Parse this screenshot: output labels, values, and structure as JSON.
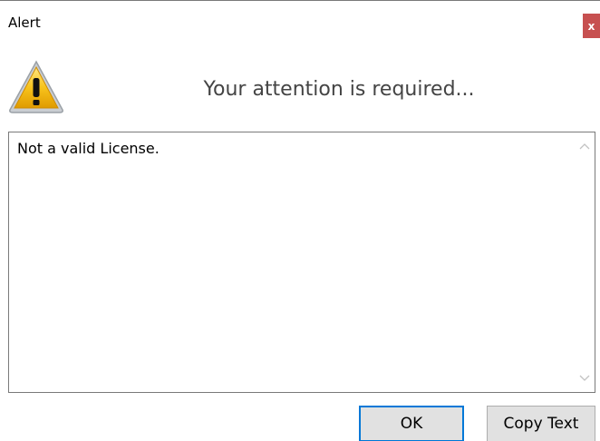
{
  "window": {
    "title": "Alert",
    "close_glyph": "x",
    "close_color": "#c75050"
  },
  "header": {
    "icon": "warning-icon",
    "message": "Your attention is required..."
  },
  "content": {
    "text": "Not a valid License."
  },
  "buttons": {
    "ok_label": "OK",
    "copy_label": "Copy Text",
    "focus_color": "#0078d7"
  }
}
